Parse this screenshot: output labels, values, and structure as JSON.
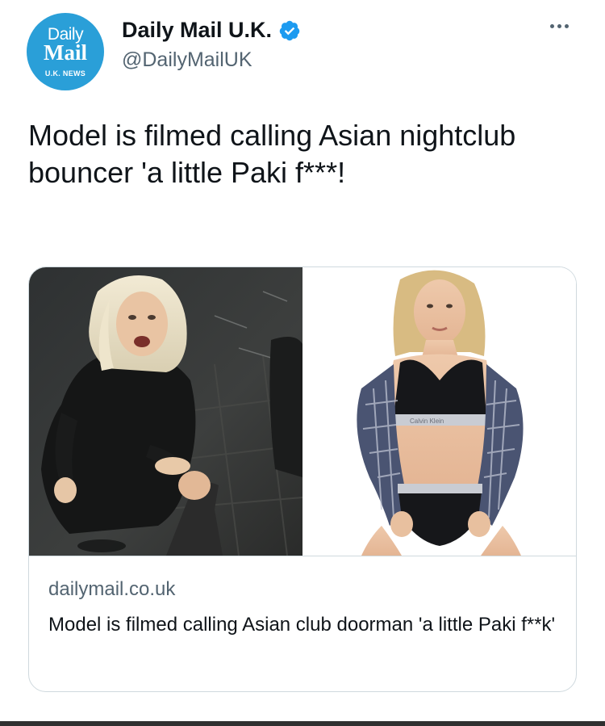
{
  "account": {
    "avatar_line1": "Daily",
    "avatar_line2": "Mail",
    "avatar_line3": "U.K. NEWS",
    "display_name": "Daily Mail U.K.",
    "handle": "@DailyMailUK",
    "verified": true
  },
  "more_icon": "ellipsis-icon",
  "tweet": {
    "text": "Model is filmed calling Asian nightclub bouncer 'a little Paki f***!"
  },
  "card": {
    "domain": "dailymail.co.uk",
    "title": "Model is filmed calling Asian club doorman 'a little Paki f**k'",
    "image_left": "woman-crouching-night-street-photo",
    "image_right": "woman-in-underwear-studio-photo",
    "underwear_text": "Calvin Klein"
  },
  "colors": {
    "brand_blue": "#2a9fd8",
    "verified_blue": "#1d9bf0",
    "secondary_text": "#536471",
    "primary_text": "#0f1419",
    "border": "#cfd9de"
  }
}
